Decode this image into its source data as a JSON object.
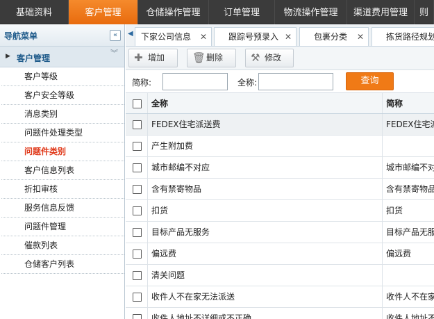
{
  "topnav": {
    "items": [
      {
        "label": "基础资料",
        "active": false
      },
      {
        "label": "客户管理",
        "active": true
      },
      {
        "label": "仓储操作管理",
        "active": false
      },
      {
        "label": "订单管理",
        "active": false
      },
      {
        "label": "物流操作管理",
        "active": false
      },
      {
        "label": "渠道费用管理",
        "active": false
      },
      {
        "label": "则",
        "active": false
      }
    ]
  },
  "sidebar": {
    "title": "导航菜单",
    "collapse_icon": "«",
    "group": {
      "label": "客户管理"
    },
    "items": [
      {
        "label": "客户等级"
      },
      {
        "label": "客户安全等级"
      },
      {
        "label": "消息类别"
      },
      {
        "label": "问题件处理类型"
      },
      {
        "label": "问题件类别",
        "active": true
      },
      {
        "label": "客户信息列表"
      },
      {
        "label": "折扣审核"
      },
      {
        "label": "服务信息反馈"
      },
      {
        "label": "问题件管理"
      },
      {
        "label": "催款列表"
      },
      {
        "label": "仓储客户列表"
      }
    ]
  },
  "tabs": [
    {
      "label": "下家公司信息"
    },
    {
      "label": "跟踪号预录入"
    },
    {
      "label": "包裹分类"
    },
    {
      "label": "拣货路径规划"
    }
  ],
  "toolbar": {
    "add_label": "增加",
    "delete_label": "删除",
    "edit_label": "修改"
  },
  "search": {
    "short_label": "简称:",
    "full_label": "全称:",
    "short_value": "",
    "full_value": "",
    "query_label": "查询"
  },
  "grid": {
    "columns": [
      "全称",
      "简称"
    ],
    "rows": [
      {
        "full": "FEDEX住宅派送费",
        "short": "FEDEX住宅派送费"
      },
      {
        "full": "产生附加费",
        "short": ""
      },
      {
        "full": "城市邮编不对应",
        "short": "城市邮编不对应"
      },
      {
        "full": "含有禁寄物品",
        "short": "含有禁寄物品"
      },
      {
        "full": "扣货",
        "short": "扣货"
      },
      {
        "full": "目标产品无服务",
        "short": "目标产品无服务"
      },
      {
        "full": "偏远费",
        "short": "偏远费"
      },
      {
        "full": "清关问题",
        "short": ""
      },
      {
        "full": "收件人不在家无法派送",
        "short": "收件人不在家无法派送"
      },
      {
        "full": "收件人地址不详细或不正确",
        "short": "收件人地址不详细或不正确"
      }
    ]
  }
}
